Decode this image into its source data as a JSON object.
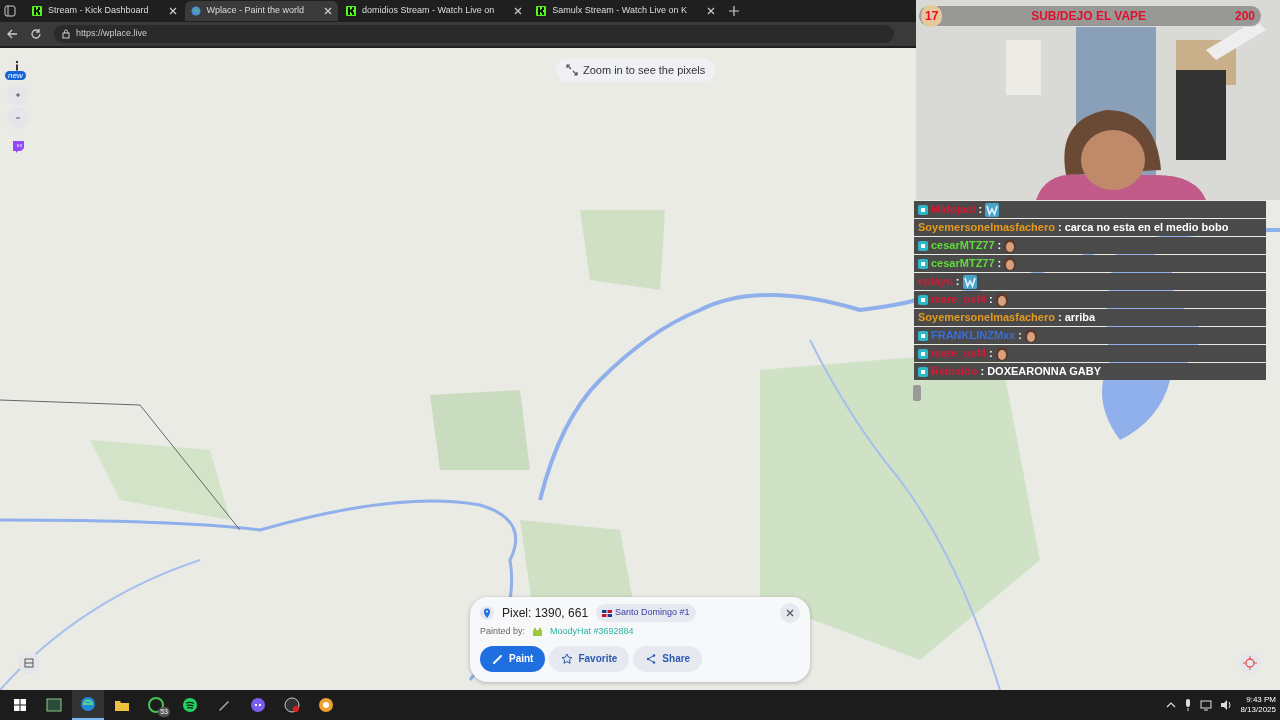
{
  "browser": {
    "tabs": [
      {
        "title": "Stream - Kick Dashboard",
        "kind": "kick",
        "selected": false
      },
      {
        "title": "Wplace - Paint the world",
        "kind": "globe",
        "selected": true
      },
      {
        "title": "domidios Stream - Watch Live on",
        "kind": "kick",
        "selected": false
      },
      {
        "title": "Samulx Stream - Watch Live on K",
        "kind": "kick",
        "selected": false
      }
    ],
    "url": "https://wplace.live"
  },
  "map": {
    "hint": "Zoom in to see the pixels",
    "new_badge": "new"
  },
  "goal": {
    "current": "17",
    "title": "SUB/DEJO EL VAPE",
    "target": "200"
  },
  "chat": {
    "separator": ":",
    "messages": [
      {
        "user": "Midojaol",
        "color": "#d11a36",
        "badge": true,
        "kind": "w-emote"
      },
      {
        "user": "Soyemersonelmasfachero",
        "color": "#e59a1c",
        "badge": false,
        "kind": "text",
        "text": "carca no esta en el medio bobo"
      },
      {
        "user": "cesarMTZ77",
        "color": "#5fdc3c",
        "badge": true,
        "kind": "face-emote"
      },
      {
        "user": "cesarMTZ77",
        "color": "#5fdc3c",
        "badge": true,
        "kind": "face-emote"
      },
      {
        "user": "eplayo",
        "color": "#d11a36",
        "badge": false,
        "kind": "w-emote"
      },
      {
        "user": "mare_osf4",
        "color": "#d11a36",
        "badge": true,
        "kind": "face-emote"
      },
      {
        "user": "Soyemersonelmasfachero",
        "color": "#e59a1c",
        "badge": false,
        "kind": "text",
        "text": "arriba"
      },
      {
        "user": "FRANKLINZMxx",
        "color": "#3a6fd8",
        "badge": true,
        "kind": "face-emote"
      },
      {
        "user": "mare_osf4",
        "color": "#d11a36",
        "badge": true,
        "kind": "face-emote"
      },
      {
        "user": "Reinaldo",
        "color": "#d11a36",
        "badge": true,
        "kind": "text",
        "text": "DOXEARONNA GABY"
      }
    ]
  },
  "pixel_card": {
    "title": "Pixel: 1390, 661",
    "region": "Santo Domingo #1",
    "painted_by": "Painted by:",
    "painter": "MoodyHat #3692884",
    "buttons": [
      {
        "label": "Paint",
        "kind": "pencil",
        "primary": true
      },
      {
        "label": "Favorite",
        "kind": "star",
        "primary": false
      },
      {
        "label": "Share",
        "kind": "share",
        "primary": false
      }
    ]
  },
  "taskbar": {
    "apps": [
      {
        "kind": "terminal",
        "selected": false
      },
      {
        "kind": "edge",
        "selected": true
      },
      {
        "kind": "folder",
        "selected": false
      },
      {
        "kind": "whatsapp",
        "selected": false,
        "badge": "53"
      },
      {
        "kind": "spotify",
        "selected": false
      },
      {
        "kind": "tool",
        "selected": false
      },
      {
        "kind": "discord",
        "selected": false
      },
      {
        "kind": "obs",
        "selected": false
      },
      {
        "kind": "chrome",
        "selected": false
      }
    ],
    "time": "9:43 PM",
    "date": "8/13/2025"
  }
}
